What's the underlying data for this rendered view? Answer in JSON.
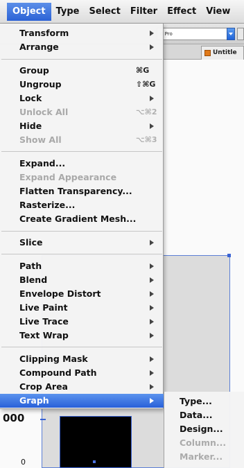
{
  "menubar": {
    "items": [
      {
        "label": "Object"
      },
      {
        "label": "Type"
      },
      {
        "label": "Select"
      },
      {
        "label": "Filter"
      },
      {
        "label": "Effect"
      },
      {
        "label": "View"
      }
    ]
  },
  "control_bar": {
    "font_field_value": "d Pro"
  },
  "document_tab": {
    "label": "Untitle"
  },
  "object_menu": {
    "items": [
      {
        "label": "Transform",
        "submenu": true
      },
      {
        "label": "Arrange",
        "submenu": true
      },
      {
        "label": "Group",
        "shortcut": "⌘G"
      },
      {
        "label": "Ungroup",
        "shortcut": "⇧⌘G"
      },
      {
        "label": "Lock",
        "submenu": true
      },
      {
        "label": "Unlock All",
        "shortcut": "⌥⌘2",
        "disabled": true
      },
      {
        "label": "Hide",
        "submenu": true
      },
      {
        "label": "Show All",
        "shortcut": "⌥⌘3",
        "disabled": true
      },
      {
        "label": "Expand..."
      },
      {
        "label": "Expand Appearance",
        "disabled": true
      },
      {
        "label": "Flatten Transparency..."
      },
      {
        "label": "Rasterize..."
      },
      {
        "label": "Create Gradient Mesh..."
      },
      {
        "label": "Slice",
        "submenu": true
      },
      {
        "label": "Path",
        "submenu": true
      },
      {
        "label": "Blend",
        "submenu": true
      },
      {
        "label": "Envelope Distort",
        "submenu": true
      },
      {
        "label": "Live Paint",
        "submenu": true
      },
      {
        "label": "Live Trace",
        "submenu": true
      },
      {
        "label": "Text Wrap",
        "submenu": true
      },
      {
        "label": "Clipping Mask",
        "submenu": true
      },
      {
        "label": "Compound Path",
        "submenu": true
      },
      {
        "label": "Crop Area",
        "submenu": true
      },
      {
        "label": "Graph",
        "submenu": true,
        "selected": true
      }
    ]
  },
  "graph_submenu": {
    "items": [
      {
        "label": "Type..."
      },
      {
        "label": "Data..."
      },
      {
        "label": "Design..."
      },
      {
        "label": "Column...",
        "disabled": true
      },
      {
        "label": "Marker...",
        "disabled": true
      }
    ]
  },
  "canvas": {
    "axis_label": "000",
    "zero_label": "0"
  },
  "colors": {
    "menu_highlight": "#2c62d6",
    "selection_blue": "#3a63d3",
    "disabled_text": "#a9a9a9"
  }
}
